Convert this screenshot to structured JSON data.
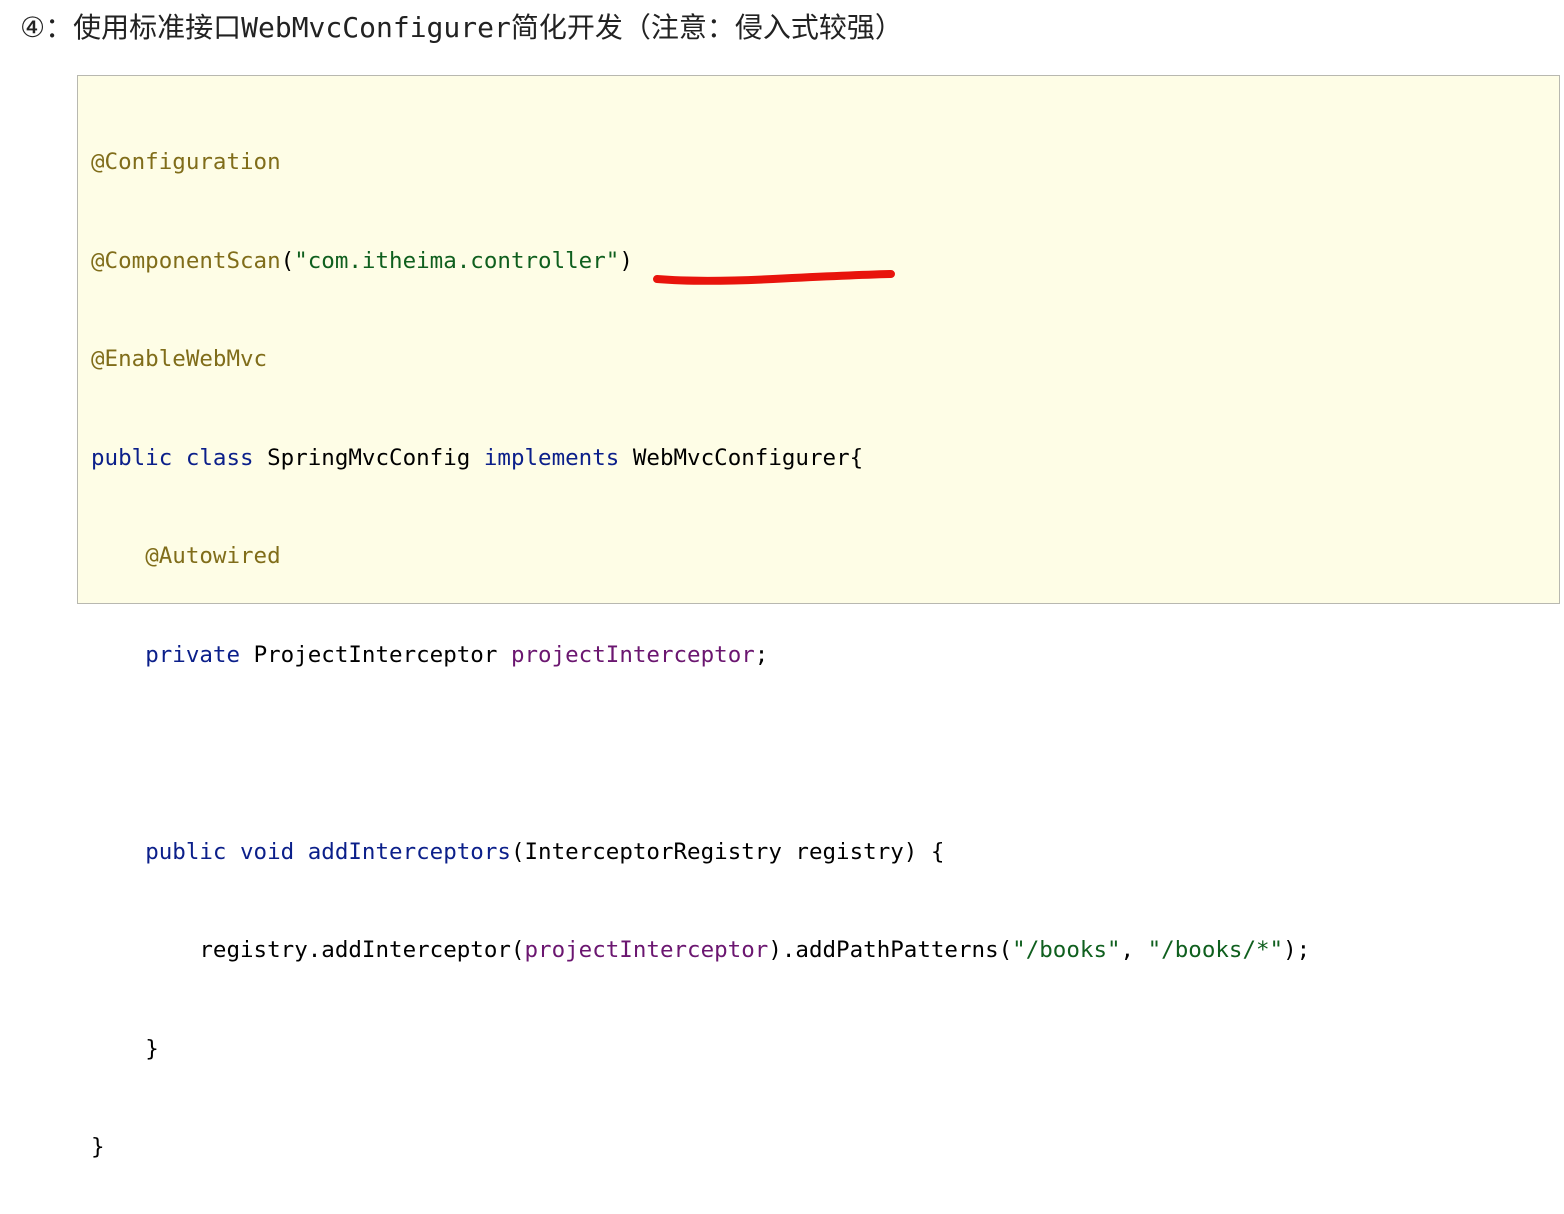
{
  "heading": {
    "marker": "④",
    "prefix": "：使用标准接口",
    "interface_name": "WebMvcConfigurer",
    "suffix": "简化开发（注意：侵入式较强）"
  },
  "code": {
    "line1": {
      "annotation": "@Configuration"
    },
    "line2": {
      "annotation": "@ComponentScan",
      "open": "(",
      "string": "\"com.itheima.controller\"",
      "close": ")"
    },
    "line3": {
      "annotation": "@EnableWebMvc"
    },
    "line4": {
      "kw1": "public",
      "kw2": "class",
      "class_name": "SpringMvcConfig",
      "kw3": "implements",
      "interface": "WebMvcConfigurer",
      "brace": "{"
    },
    "line5": {
      "indent": "    ",
      "annotation": "@Autowired"
    },
    "line6": {
      "indent": "    ",
      "kw": "private",
      "type": "ProjectInterceptor",
      "field": "projectInterceptor",
      "end": ";"
    },
    "line8": {
      "indent": "    ",
      "kw1": "public",
      "kw2": "void",
      "method": "addInterceptors",
      "params": "(InterceptorRegistry registry) {"
    },
    "line9": {
      "indent": "        ",
      "call": "registry.addInterceptor(",
      "field": "projectInterceptor",
      "chain": ").addPathPatterns(",
      "str1": "\"/books\"",
      "comma": ", ",
      "str2": "\"/books/*\"",
      "end": ");"
    },
    "line10": {
      "indent": "    ",
      "brace": "}"
    },
    "line11": {
      "brace": "}"
    }
  },
  "colors": {
    "annotation": "#806d1a",
    "keyword": "#0b1f8a",
    "string": "#0f5f1e",
    "field": "#6b1670",
    "box_background": "#fefde6",
    "underline": "#e8140c"
  }
}
